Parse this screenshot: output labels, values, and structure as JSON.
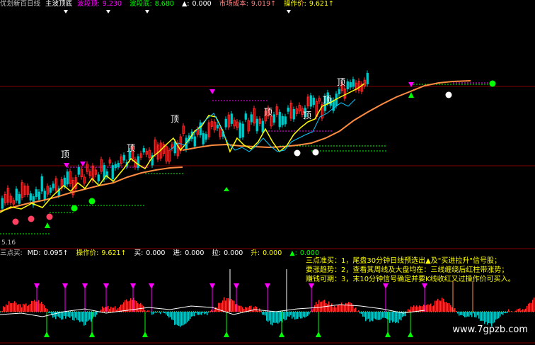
{
  "main_legend": {
    "title": "优划新百日线",
    "indicator": "主波顶底",
    "items": [
      {
        "label": "波段顶:",
        "value": "9.230",
        "color": "#ff00ff"
      },
      {
        "label": "波段底:",
        "value": "8.680",
        "color": "#00ff00"
      },
      {
        "label": "▲:",
        "value": "0.000",
        "color": "#ffffff"
      },
      {
        "label": "市场成本:",
        "value": "9.019↑",
        "color": "#ff8080"
      },
      {
        "label": "操作价:",
        "value": "9.621↑",
        "color": "#ffff00"
      }
    ]
  },
  "price_tag": "5.16",
  "peak_labels": [
    "顶",
    "顶",
    "顶",
    "顶",
    "顶",
    "顶",
    "顶"
  ],
  "sub_legend": {
    "title": "三点买:",
    "items": [
      {
        "label": "MD:",
        "value": "0.095↑",
        "color": "#ffffff"
      },
      {
        "label": "操作价:",
        "value": "9.621↑",
        "color": "#ffff00"
      },
      {
        "label": "买:",
        "value": "0.000",
        "color": "#ffffff"
      },
      {
        "label": "进:",
        "value": "0.000",
        "color": "#ffffff"
      },
      {
        "label": "拉:",
        "value": "0.000",
        "color": "#ffffff"
      },
      {
        "label": "升:",
        "value": "0.000",
        "color": "#ffff00"
      },
      {
        "label": "▲:",
        "value": "0.000",
        "color": "#00ff00"
      }
    ]
  },
  "notes": [
    "三点准买：1，尾盘30分钟日线预选出▲及\"买进拉升\"信号股；",
    "要涨趋势：2，查看其周线及大盘均在：三线缠绕后红柱带涨势；",
    "赚钱可期：3，末10分钟信号确定并要K线收红又过操作价可买入。"
  ],
  "watermark": "www.7gpzb.com",
  "colors": {
    "up": "#ff3030",
    "down": "#00c8c8",
    "cost_line": "#ff8c40",
    "op_line": "#ffff00",
    "top_mark": "#ff00ff",
    "bottom_mark": "#00ff00",
    "grid": "#800000"
  }
}
